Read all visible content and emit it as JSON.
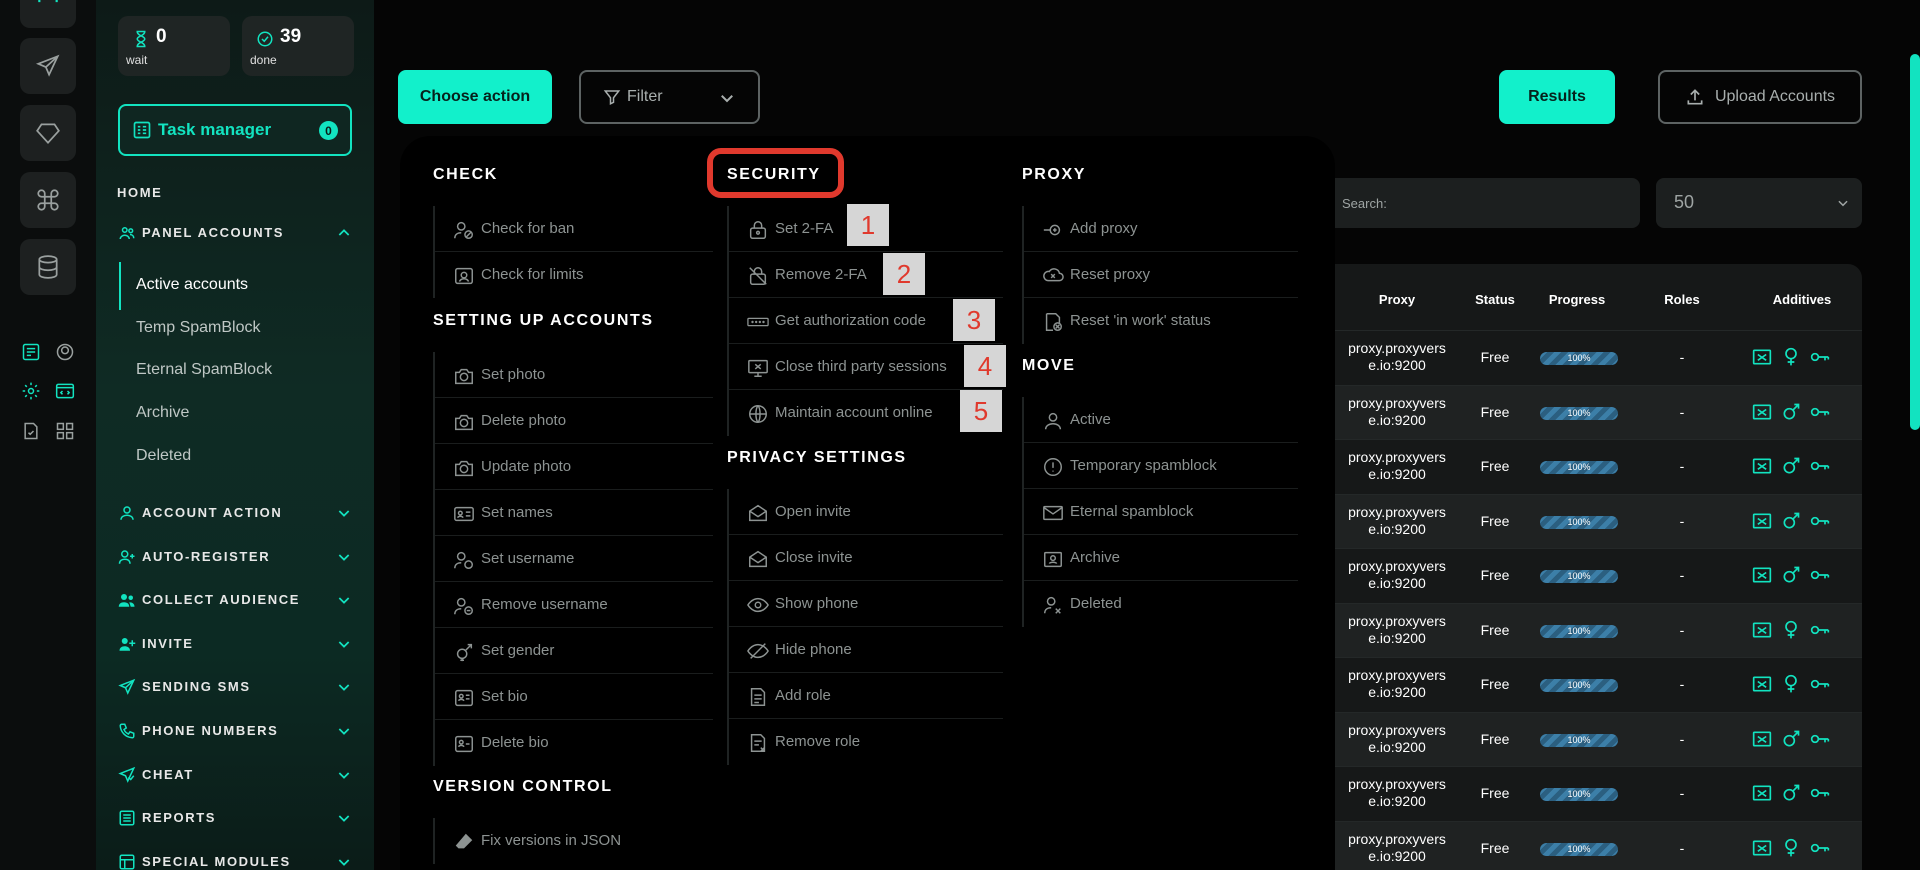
{
  "stats": [
    {
      "count": "0",
      "label": "wait",
      "icon": "hourglass-icon"
    },
    {
      "count": "39",
      "label": "done",
      "icon": "check-circle-icon"
    }
  ],
  "task_manager": {
    "label": "Task manager",
    "badge": "0"
  },
  "nav": {
    "home": "HOME",
    "panel_accounts": {
      "label": "PANEL ACCOUNTS",
      "items": [
        "Active accounts",
        "Temp SpamBlock",
        "Eternal SpamBlock",
        "Archive",
        "Deleted"
      ],
      "active": "Active accounts"
    },
    "groups": [
      {
        "label": "ACCOUNT ACTION",
        "icon": "user-icon"
      },
      {
        "label": "AUTO-REGISTER",
        "icon": "user-plus-icon"
      },
      {
        "label": "COLLECT AUDIENCE",
        "icon": "users-icon"
      },
      {
        "label": "INVITE",
        "icon": "user-add-icon"
      },
      {
        "label": "SENDING SMS",
        "icon": "send-icon"
      },
      {
        "label": "PHONE NUMBERS",
        "icon": "phone-icon"
      },
      {
        "label": "CHEAT",
        "icon": "cheat-icon"
      },
      {
        "label": "REPORTS",
        "icon": "report-icon"
      },
      {
        "label": "SPECIAL MODULES",
        "icon": "modules-icon"
      }
    ]
  },
  "toolbar": {
    "choose_action": "Choose action",
    "filter": "Filter",
    "results": "Results",
    "upload": "Upload Accounts"
  },
  "table": {
    "search_placeholder": "Search:",
    "page_size": "50",
    "headers": [
      "Proxy",
      "Status",
      "Progress",
      "Roles",
      "Additives"
    ],
    "rows": [
      {
        "proxy_line1": "proxy.proxyvers",
        "proxy_line2": "e.io:9200",
        "status": "Free",
        "progress": "100%",
        "roles": "-",
        "gender": "female"
      },
      {
        "proxy_line1": "proxy.proxyvers",
        "proxy_line2": "e.io:9200",
        "status": "Free",
        "progress": "100%",
        "roles": "-",
        "gender": "male"
      },
      {
        "proxy_line1": "proxy.proxyvers",
        "proxy_line2": "e.io:9200",
        "status": "Free",
        "progress": "100%",
        "roles": "-",
        "gender": "male"
      },
      {
        "proxy_line1": "proxy.proxyvers",
        "proxy_line2": "e.io:9200",
        "status": "Free",
        "progress": "100%",
        "roles": "-",
        "gender": "male"
      },
      {
        "proxy_line1": "proxy.proxyvers",
        "proxy_line2": "e.io:9200",
        "status": "Free",
        "progress": "100%",
        "roles": "-",
        "gender": "male"
      },
      {
        "proxy_line1": "proxy.proxyvers",
        "proxy_line2": "e.io:9200",
        "status": "Free",
        "progress": "100%",
        "roles": "-",
        "gender": "female"
      },
      {
        "proxy_line1": "proxy.proxyvers",
        "proxy_line2": "e.io:9200",
        "status": "Free",
        "progress": "100%",
        "roles": "-",
        "gender": "female"
      },
      {
        "proxy_line1": "proxy.proxyvers",
        "proxy_line2": "e.io:9200",
        "status": "Free",
        "progress": "100%",
        "roles": "-",
        "gender": "male"
      },
      {
        "proxy_line1": "proxy.proxyvers",
        "proxy_line2": "e.io:9200",
        "status": "Free",
        "progress": "100%",
        "roles": "-",
        "gender": "male"
      },
      {
        "proxy_line1": "proxy.proxyvers",
        "proxy_line2": "e.io:9200",
        "status": "Free",
        "progress": "100%",
        "roles": "-",
        "gender": "female"
      }
    ]
  },
  "menu": {
    "check": {
      "title": "CHECK",
      "items": [
        "Check for ban",
        "Check for limits"
      ]
    },
    "setting_up": {
      "title": "SETTING UP ACCOUNTS",
      "items": [
        "Set photo",
        "Delete photo",
        "Update photo",
        "Set names",
        "Set username",
        "Remove username",
        "Set gender",
        "Set bio",
        "Delete bio"
      ]
    },
    "version_control": {
      "title": "VERSION CONTROL",
      "items": [
        "Fix versions in JSON"
      ]
    },
    "security": {
      "title": "SECURITY",
      "items": [
        "Set 2-FA",
        "Remove 2-FA",
        "Get authorization code",
        "Close third party sessions",
        "Maintain account online"
      ]
    },
    "privacy": {
      "title": "PRIVACY SETTINGS",
      "items": [
        "Open invite",
        "Close invite",
        "Show phone",
        "Hide phone",
        "Add role",
        "Remove role"
      ]
    },
    "proxy": {
      "title": "PROXY",
      "items": [
        "Add proxy",
        "Reset proxy",
        "Reset 'in work' status"
      ]
    },
    "move": {
      "title": "MOVE",
      "items": [
        "Active",
        "Temporary spamblock",
        "Eternal spamblock",
        "Archive",
        "Deleted"
      ]
    }
  },
  "annotations": [
    "1",
    "2",
    "3",
    "4",
    "5"
  ],
  "colors": {
    "accent": "#12f0cb",
    "highlight": "#e0392d"
  }
}
